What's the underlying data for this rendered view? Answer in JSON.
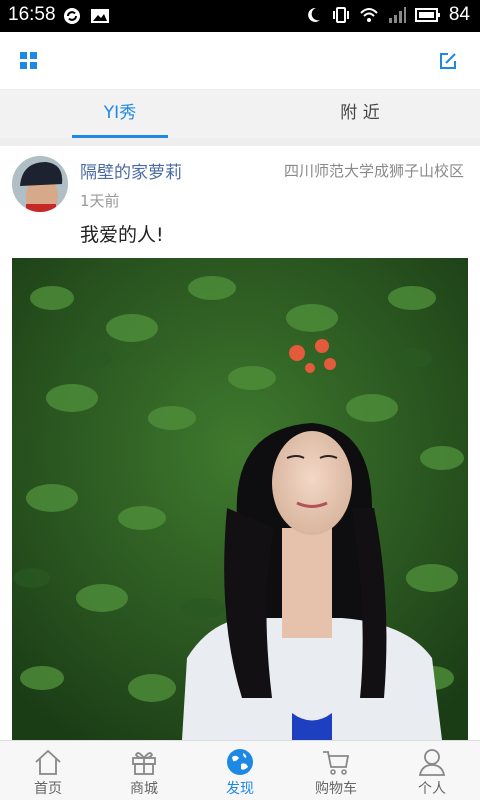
{
  "status_bar": {
    "time": "16:58",
    "battery": "84",
    "icons": [
      "sync-icon",
      "image-icon",
      "moon-icon",
      "vibrate-icon",
      "wifi-icon",
      "signal-icon",
      "battery-icon"
    ]
  },
  "top_bar": {
    "left_icon": "grid-icon",
    "right_icon": "edit-icon"
  },
  "tabs": [
    {
      "label": "YI秀",
      "active": true
    },
    {
      "label": "附 近",
      "active": false
    }
  ],
  "post": {
    "username": "隔壁的家萝莉",
    "location": "四川师范大学成狮子山校区",
    "time_ago": "1天前",
    "text": "我爱的人!",
    "photo": "photo of a woman with long dark hair looking up in front of green foliage with orange flowers"
  },
  "bottom_nav": {
    "items": [
      {
        "label": "首页",
        "icon": "home-icon",
        "active": false
      },
      {
        "label": "商城",
        "icon": "gift-icon",
        "active": false
      },
      {
        "label": "发现",
        "icon": "globe-icon",
        "active": true
      },
      {
        "label": "购物车",
        "icon": "cart-icon",
        "active": false
      },
      {
        "label": "个人",
        "icon": "person-icon",
        "active": false
      }
    ]
  },
  "colors": {
    "accent": "#1e88e5",
    "username": "#4a6aa5",
    "status_bar": "#000000"
  }
}
